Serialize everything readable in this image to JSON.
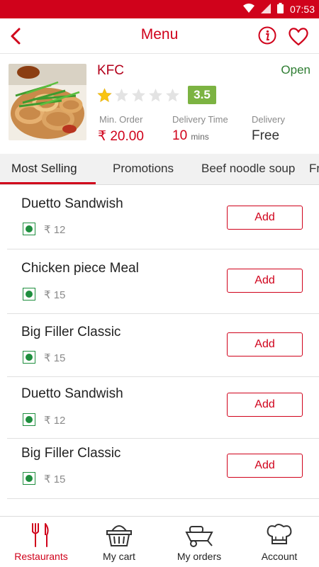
{
  "status_bar": {
    "time": "07:53"
  },
  "header": {
    "title": "Menu"
  },
  "restaurant": {
    "name": "KFC",
    "status": "Open",
    "rating_stars": 1,
    "rating_max": 5,
    "rating": "3.5",
    "min_order_label": "Min. Order",
    "min_order_value": "₹ 20.00",
    "delivery_time_label": "Delivery Time",
    "delivery_time_value": "10",
    "delivery_time_unit": "mins",
    "delivery_label": "Delivery",
    "delivery_value": "Free"
  },
  "tabs": [
    {
      "label": "Most Selling",
      "active": true
    },
    {
      "label": "Promotions"
    },
    {
      "label": "Beef noodle soup"
    },
    {
      "label": "Fr"
    }
  ],
  "items": [
    {
      "name": "Duetto Sandwish",
      "price": "₹ 12",
      "add_label": "Add"
    },
    {
      "name": "Chicken piece Meal",
      "price": "₹ 15",
      "add_label": "Add"
    },
    {
      "name": "Big Filler Classic",
      "price": "₹ 15",
      "add_label": "Add"
    },
    {
      "name": "Duetto Sandwish",
      "price": "₹ 12",
      "add_label": "Add"
    },
    {
      "name": "Big Filler Classic",
      "price": "₹ 15",
      "add_label": "Add"
    }
  ],
  "bottom_nav": [
    {
      "label": "Restaurants",
      "icon": "fork-knife-icon",
      "active": true
    },
    {
      "label": "My cart",
      "icon": "basket-icon"
    },
    {
      "label": "My orders",
      "icon": "wheelbarrow-icon"
    },
    {
      "label": "Account",
      "icon": "chef-hat-icon"
    }
  ],
  "colors": {
    "accent": "#d0021b",
    "open_green": "#2e7d32",
    "rating_green": "#7cb342",
    "veg_green": "#1e8e3e"
  }
}
